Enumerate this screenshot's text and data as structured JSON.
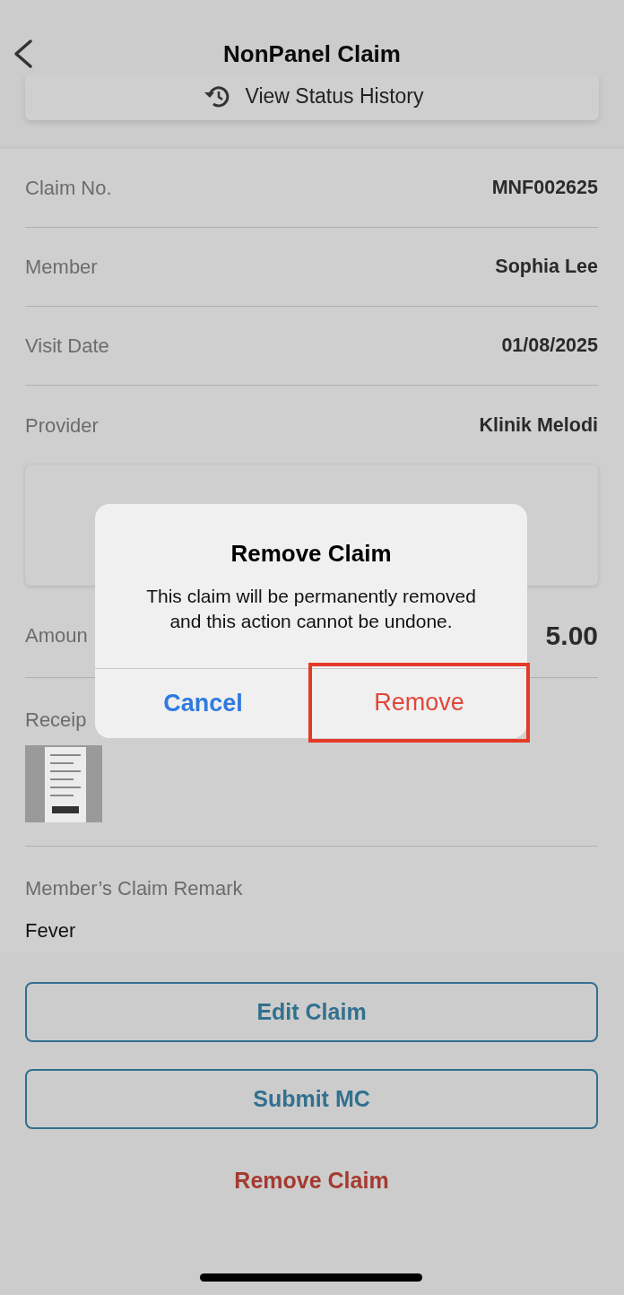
{
  "header": {
    "title": "NonPanel Claim"
  },
  "status_history": {
    "label": "View Status History"
  },
  "details": [
    {
      "label": "Claim No.",
      "value": "MNF002625"
    },
    {
      "label": "Member",
      "value": "Sophia Lee"
    },
    {
      "label": "Visit Date",
      "value": "01/08/2025"
    },
    {
      "label": "Provider",
      "value": "Klinik Melodi"
    }
  ],
  "amount": {
    "label": "Amoun",
    "value": "5.00"
  },
  "receipt": {
    "label": "Receip"
  },
  "remark": {
    "label": "Member’s Claim Remark",
    "value": "Fever"
  },
  "buttons": [
    {
      "label": "Edit Claim",
      "kind": "outline"
    },
    {
      "label": "Submit MC",
      "kind": "outline"
    },
    {
      "label": "Remove Claim",
      "kind": "danger-text"
    }
  ],
  "dialog": {
    "title": "Remove Claim",
    "message": "This claim will be permanently removed and this action cannot be undone.",
    "actions": [
      {
        "label": "Cancel",
        "kind": "cancel",
        "highlighted": false
      },
      {
        "label": "Remove",
        "kind": "destructive",
        "highlighted": true
      }
    ]
  }
}
